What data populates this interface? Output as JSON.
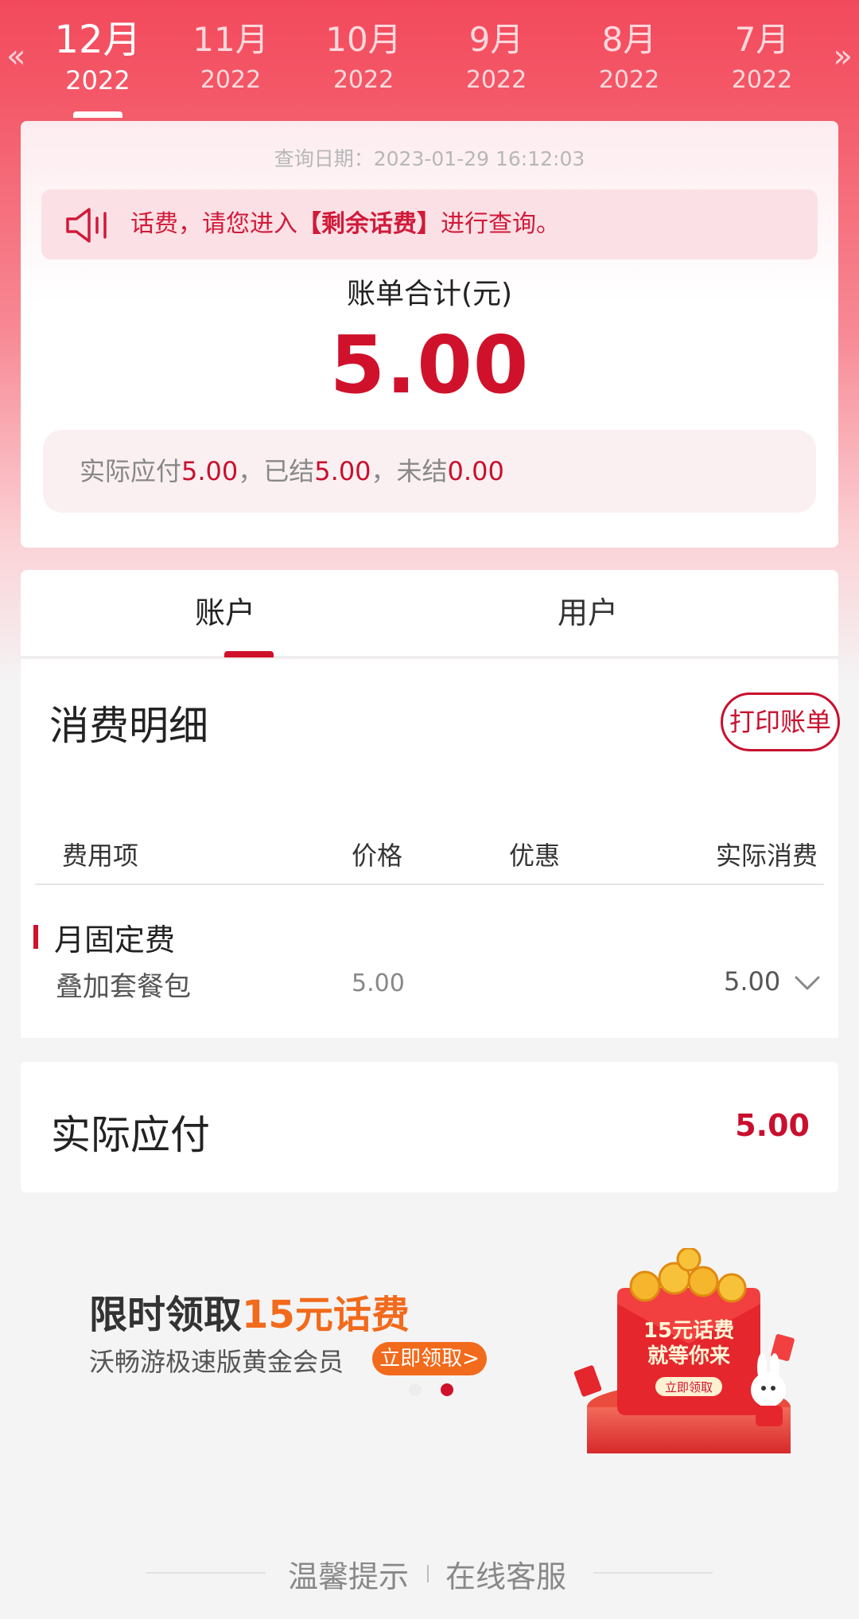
{
  "months": [
    {
      "month": "12月",
      "year": "2022",
      "active": true
    },
    {
      "month": "11月",
      "year": "2022",
      "active": false
    },
    {
      "month": "10月",
      "year": "2022",
      "active": false
    },
    {
      "month": "9月",
      "year": "2022",
      "active": false
    },
    {
      "month": "8月",
      "year": "2022",
      "active": false
    },
    {
      "month": "7月",
      "year": "2022",
      "active": false
    }
  ],
  "nav": {
    "prev_icon": "«",
    "next_icon": "»"
  },
  "summary": {
    "query_date": "查询日期：2023-01-29 16:12:03",
    "notice_prefix": "话费，请您进入",
    "notice_bold": "【剩余话费】",
    "notice_suffix": "进行查询。",
    "bill_label": "账单合计(元)",
    "bill_amount": "5.00",
    "settle_l1": "实际应付",
    "settle_v1": "5.00",
    "settle_l2": "，已结",
    "settle_v2": "5.00",
    "settle_l3": "，未结",
    "settle_v3": "0.00"
  },
  "tabs": [
    {
      "label": "账户",
      "active": true
    },
    {
      "label": "用户",
      "active": false
    }
  ],
  "detail": {
    "title": "消费明细",
    "print_button": "打印账单",
    "headers": [
      "费用项",
      "价格",
      "优惠",
      "实际消费"
    ],
    "group": "月固定费",
    "rows": [
      {
        "name": "叠加套餐包",
        "price": "5.00",
        "discount": "",
        "actual": "5.00"
      }
    ]
  },
  "pay": {
    "label": "实际应付",
    "amount": "5.00"
  },
  "banner": {
    "title_main": "限时领取",
    "title_highlight": "15元话费",
    "subtitle": "沃畅游极速版黄金会员",
    "button": "立即领取>",
    "art_line1": "15元话费",
    "art_line2": "就等你来",
    "art_button": "立即领取"
  },
  "footer": {
    "tip": "温馨提示",
    "service": "在线客服"
  },
  "colors": {
    "primary": "#d0112b",
    "accent_orange": "#f26a1b",
    "header_red": "#f24a5c"
  }
}
